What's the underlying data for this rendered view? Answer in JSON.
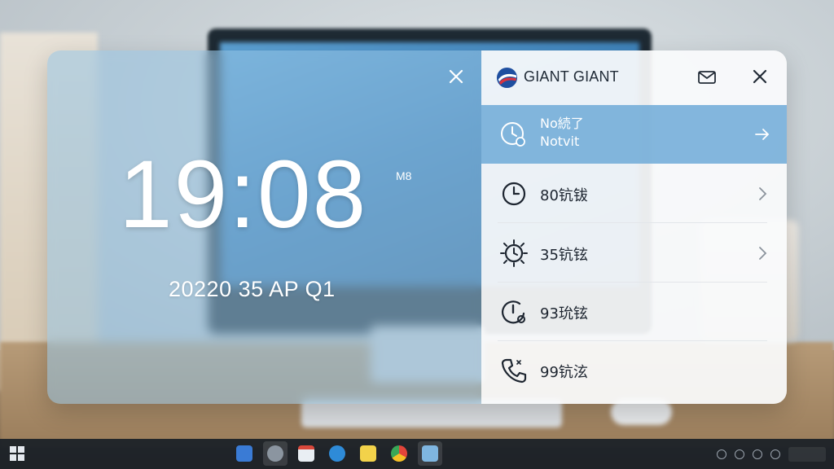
{
  "clock": {
    "time": "19:08",
    "ampm": "M8",
    "date": "20220 35 AP Q1"
  },
  "panel": {
    "brand": "GIANT GIANT",
    "items": [
      {
        "line1": "No続了",
        "line2": "Notvit",
        "icon": "clock-notification-icon",
        "highlighted": true
      },
      {
        "label": "80钪钹",
        "icon": "clock-icon"
      },
      {
        "label": "35钪铉",
        "icon": "timer-sun-icon"
      },
      {
        "label": "93玧铉",
        "icon": "alarm-alert-icon"
      },
      {
        "label": "99钪泫",
        "icon": "phone-icon"
      }
    ]
  },
  "colors": {
    "accent": "#6eaad7",
    "clock_pane": "#96c3e1",
    "panel_bg": "#fafbfc",
    "brand_red": "#d9333f",
    "brand_blue": "#1f4fa0"
  }
}
